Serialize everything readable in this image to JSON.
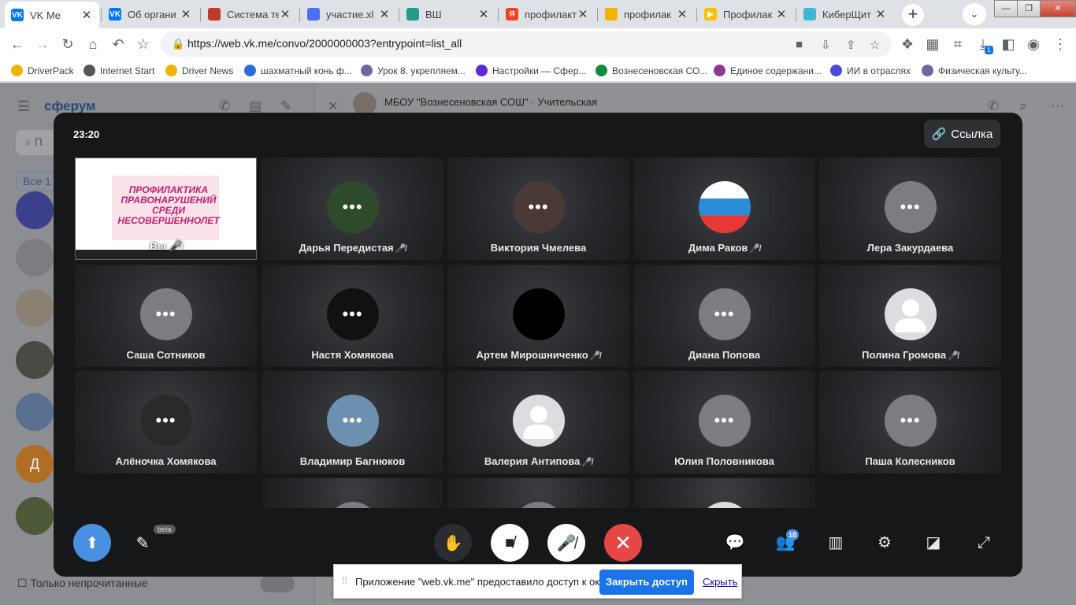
{
  "browser": {
    "tabs": [
      {
        "title": "VK Me",
        "active": true,
        "favicon_color": "#0077ff",
        "favicon_text": "VK"
      },
      {
        "title": "Об органи",
        "active": false,
        "favicon_color": "#0077ff",
        "favicon_text": "VK"
      },
      {
        "title": "Система те",
        "active": false,
        "favicon_color": "#c0392b",
        "favicon_text": ""
      },
      {
        "title": "участие.xl",
        "active": false,
        "favicon_color": "#4c6ef5",
        "favicon_text": ""
      },
      {
        "title": "ВШ",
        "active": false,
        "favicon_color": "#1e9e8a",
        "favicon_text": ""
      },
      {
        "title": "профилакт",
        "active": false,
        "favicon_color": "#fc3f1d",
        "favicon_text": "Я"
      },
      {
        "title": "профилак",
        "active": false,
        "favicon_color": "#f3b300",
        "favicon_text": ""
      },
      {
        "title": "Профилак",
        "active": false,
        "favicon_color": "#fdc000",
        "favicon_text": "▶"
      },
      {
        "title": "КиберЩит",
        "active": false,
        "favicon_color": "#3fb7d6",
        "favicon_text": ""
      }
    ],
    "url": "https://web.vk.me/convo/2000000003?entrypoint=list_all",
    "bookmarks": [
      {
        "label": "DriverPack",
        "color": "#f0b400"
      },
      {
        "label": "Internet Start",
        "color": "#555555"
      },
      {
        "label": "Driver News",
        "color": "#f0b400"
      },
      {
        "label": "шахматный конь ф...",
        "color": "#2d6cdf"
      },
      {
        "label": "Урок 8. укрепляем...",
        "color": "#6b6b9b"
      },
      {
        "label": "Настройки — Сфер...",
        "color": "#5a2bd6"
      },
      {
        "label": "Вознесеновская СО...",
        "color": "#168a3a"
      },
      {
        "label": "Единое содержани...",
        "color": "#8f3a8f"
      },
      {
        "label": "ИИ в отраслях",
        "color": "#4a4ad6"
      },
      {
        "label": "Физическая культу...",
        "color": "#6b6b9b"
      }
    ],
    "download_count": "1"
  },
  "vk": {
    "logo": "сферум",
    "search_placeholder": "П",
    "filter_all": "Все",
    "filter_count": "1",
    "unread_only": "Только непрочитанные",
    "chat_title": "МБОУ \"Вознесеновская СОШ\" · Учительская",
    "avatar_letter": "Д"
  },
  "call": {
    "timer": "23:20",
    "link_label": "Ссылка",
    "screen_share": {
      "name": "Вы",
      "slide_text": "ПРОФИЛАКТИКА ПРАВОНАРУШЕНИЙ СРЕДИ НЕСОВЕРШЕННОЛЕТ"
    },
    "participants": [
      {
        "name": "Дарья Передистая",
        "muted": true,
        "avatar": "photo",
        "color": "#2f4a2a"
      },
      {
        "name": "Виктория Чмелева",
        "muted": false,
        "avatar": "photo",
        "color": "#4a3a35"
      },
      {
        "name": "Дима Раков",
        "muted": true,
        "avatar": "flag",
        "color": "#2a8bd6"
      },
      {
        "name": "Лера Закурдаева",
        "muted": false,
        "avatar": "none",
        "color": "#7b7d82"
      },
      {
        "name": "Саша Сотников",
        "muted": false,
        "avatar": "none",
        "color": "#7b7d82"
      },
      {
        "name": "Настя Хомякова",
        "muted": false,
        "avatar": "photo",
        "color": "#111111"
      },
      {
        "name": "Артем Мирошниченко",
        "muted": true,
        "avatar": "photo",
        "color": "#000000"
      },
      {
        "name": "Диана Попова",
        "muted": false,
        "avatar": "none",
        "color": "#7b7d82"
      },
      {
        "name": "Полина Громова",
        "muted": true,
        "avatar": "light",
        "color": "#dcdde0"
      },
      {
        "name": "Алёночка Хомякова",
        "muted": false,
        "avatar": "photo",
        "color": "#2a2a2a"
      },
      {
        "name": "Владимир Багнюков",
        "muted": false,
        "avatar": "photo",
        "color": "#6d8fb0"
      },
      {
        "name": "Валерия Антипова",
        "muted": true,
        "avatar": "light",
        "color": "#dcdde0"
      },
      {
        "name": "Юлия Половникова",
        "muted": false,
        "avatar": "none",
        "color": "#7b7d82"
      },
      {
        "name": "Паша Колесников",
        "muted": false,
        "avatar": "none",
        "color": "#7b7d82"
      }
    ],
    "beta_label": "beta",
    "participants_count": "18"
  },
  "share_bar": {
    "message": "Приложение \"web.vk.me\" предоставило доступ к окну.",
    "stop_label": "Закрыть доступ",
    "hide_label": "Скрыть"
  }
}
